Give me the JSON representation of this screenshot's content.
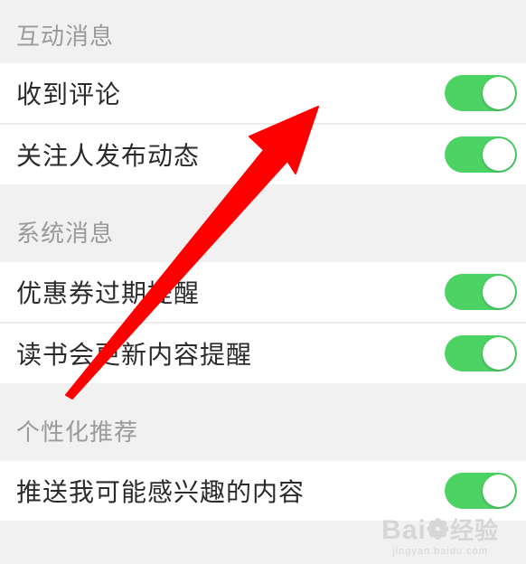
{
  "colors": {
    "background": "#f1f1f1",
    "row_background": "#ffffff",
    "toggle_on": "#4cd364",
    "arrow": "#ff0000",
    "section_text": "#9a9a9a",
    "row_text": "#2b2b2b"
  },
  "sections": [
    {
      "title": "互动消息",
      "items": [
        {
          "label": "收到评论",
          "toggle_on": true
        },
        {
          "label": "关注人发布动态",
          "toggle_on": true
        }
      ]
    },
    {
      "title": "系统消息",
      "items": [
        {
          "label": "优惠券过期提醒",
          "toggle_on": true
        },
        {
          "label": "读书会更新内容提醒",
          "toggle_on": true
        }
      ]
    },
    {
      "title": "个性化推荐",
      "items": [
        {
          "label": "推送我可能感兴趣的内容",
          "toggle_on": true
        }
      ]
    }
  ],
  "annotation": {
    "icon": "red-arrow-icon"
  },
  "watermark": {
    "logo_latin": "Bai",
    "logo_zh": "经验",
    "site": "jingyan.baidu.com"
  }
}
